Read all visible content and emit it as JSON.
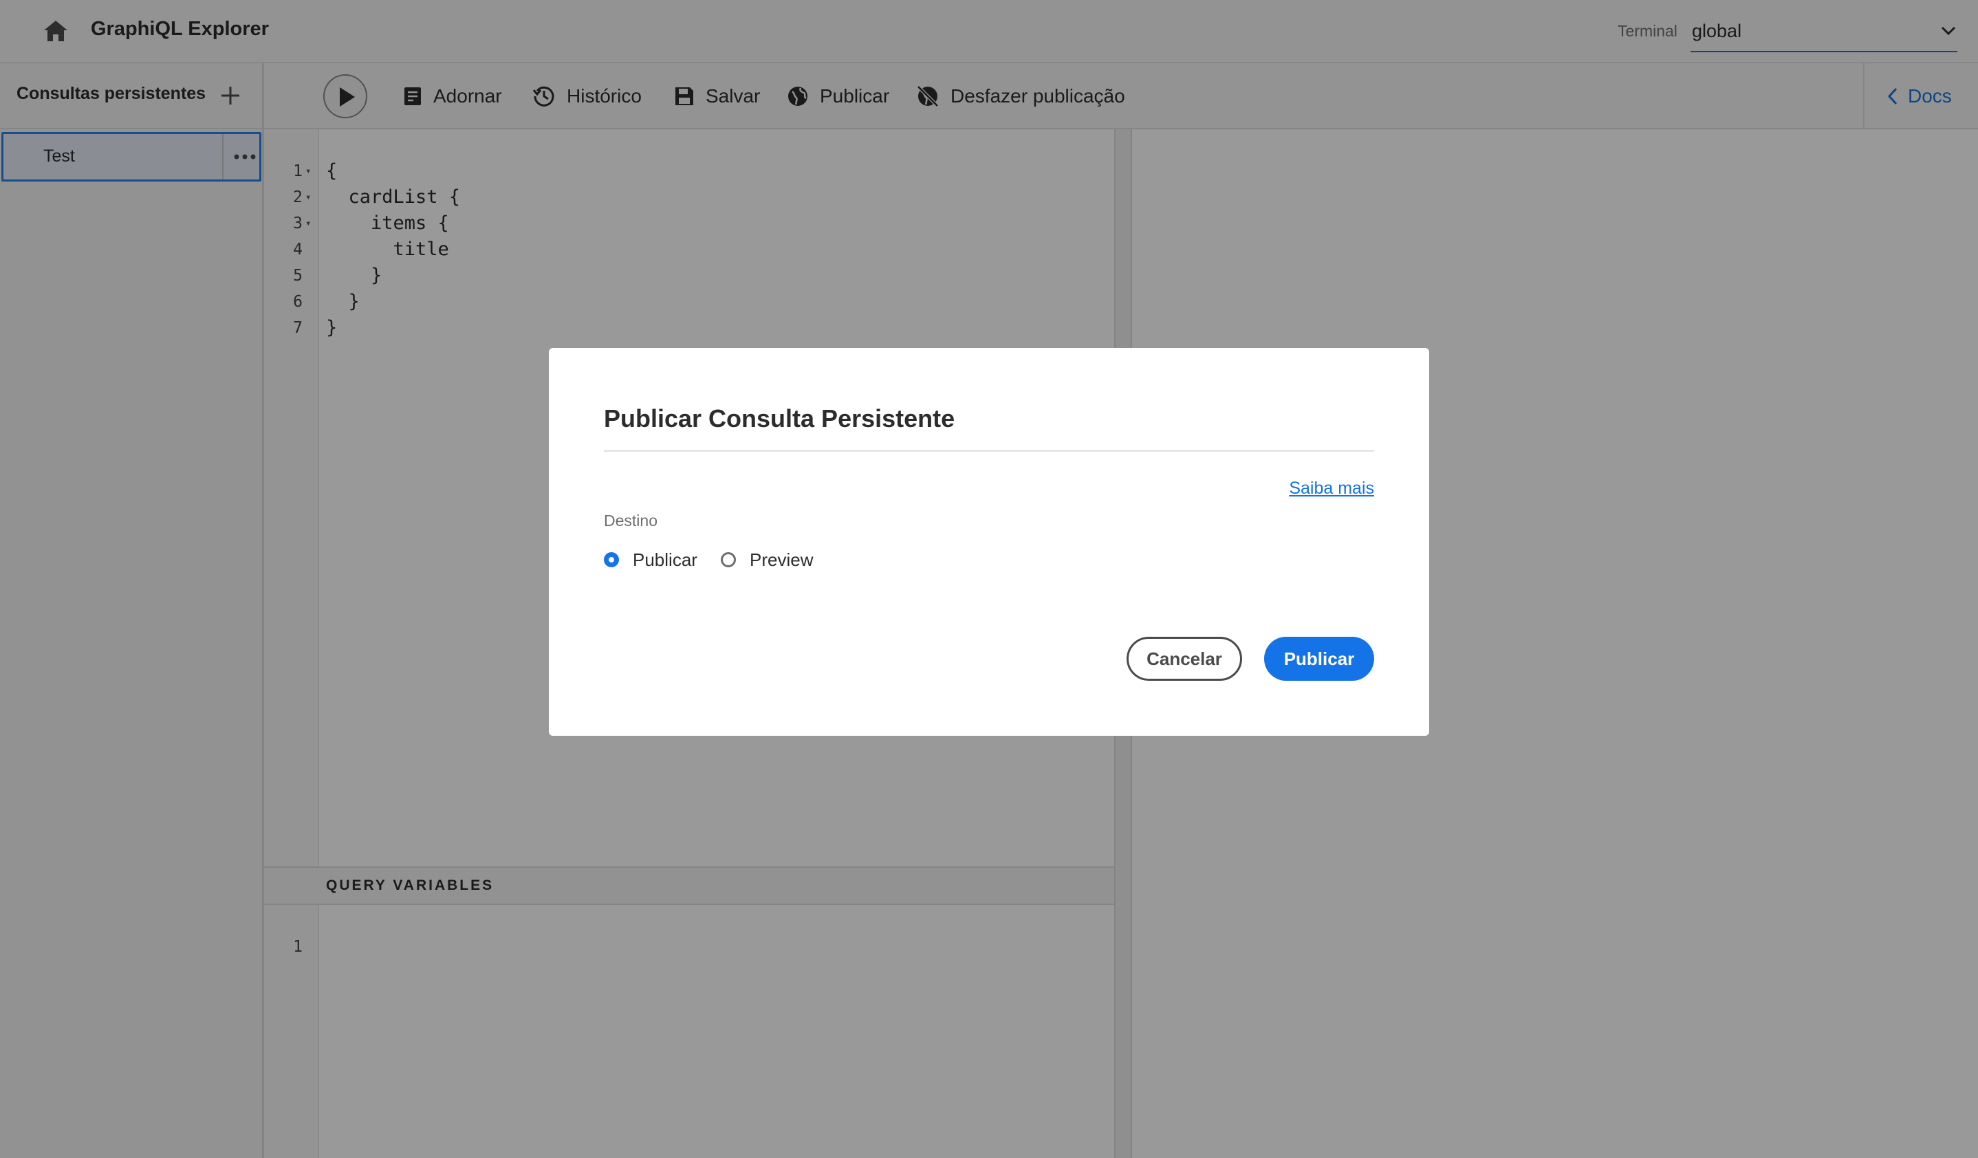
{
  "header": {
    "title": "GraphiQL Explorer",
    "endpoint_label": "Terminal",
    "endpoint_value": "global"
  },
  "sidebar": {
    "title": "Consultas persistentes",
    "items": [
      {
        "label": "Test"
      }
    ]
  },
  "toolbar": {
    "adornar": "Adornar",
    "historico": "Histórico",
    "salvar": "Salvar",
    "publicar": "Publicar",
    "desfazer": "Desfazer publicação",
    "docs": "Docs"
  },
  "editor": {
    "lines": [
      {
        "num": "1",
        "fold": "▾",
        "code": "{"
      },
      {
        "num": "2",
        "fold": "▾",
        "code": "  cardList {"
      },
      {
        "num": "3",
        "fold": "▾",
        "code": "    items {"
      },
      {
        "num": "4",
        "fold": "",
        "code": "      title"
      },
      {
        "num": "5",
        "fold": "",
        "code": "    }"
      },
      {
        "num": "6",
        "fold": "",
        "code": "  }"
      },
      {
        "num": "7",
        "fold": "",
        "code": "}"
      }
    ]
  },
  "variables": {
    "title": "QUERY VARIABLES",
    "line_num": "1"
  },
  "dialog": {
    "title": "Publicar Consulta Persistente",
    "learn_more": "Saiba mais",
    "destination_label": "Destino",
    "options": [
      {
        "label": "Publicar",
        "checked": true
      },
      {
        "label": "Preview",
        "checked": false
      }
    ],
    "cancel": "Cancelar",
    "publish": "Publicar"
  },
  "colors": {
    "accent": "#1473e6",
    "overlay": "rgba(0,0,0,0.4)"
  }
}
